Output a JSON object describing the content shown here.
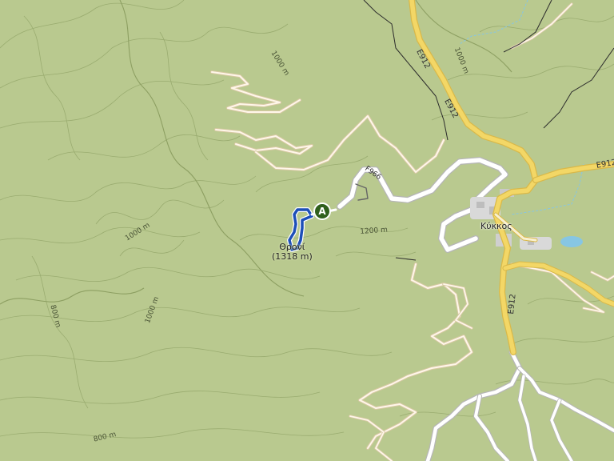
{
  "map": {
    "place_label": "Κύκκος",
    "peak_name": "Θρονί",
    "peak_elevation": "(1318 m)",
    "marker_label": "A",
    "road_labels": {
      "e912": "E912",
      "f966": "F966"
    },
    "contours": {
      "c1000": "1000 m",
      "c800": "800 m",
      "c1200": "1200 m"
    },
    "colors": {
      "terrain": "#b9c98f",
      "highway": "#f3d766",
      "route": "#1d4fb8",
      "marker": "#2f5f1c",
      "water": "#87c6e3"
    }
  }
}
